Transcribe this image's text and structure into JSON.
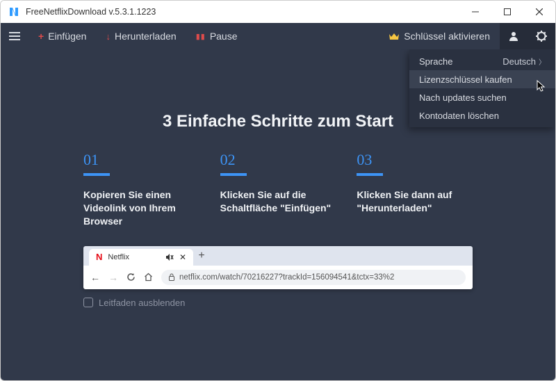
{
  "window": {
    "title": "FreeNetflixDownload  v.5.3.1.1223"
  },
  "toolbar": {
    "paste": "Einfügen",
    "download": "Herunterladen",
    "pause": "Pause",
    "activate": "Schlüssel aktivieren"
  },
  "dropdown": {
    "language_label": "Sprache",
    "language_value": "Deutsch",
    "buy": "Lizenzschlüssel kaufen",
    "updates": "Nach updates suchen",
    "delete": "Kontodaten löschen"
  },
  "main": {
    "heading": "3 Einfache Schritte zum Start",
    "steps": [
      {
        "num": "01",
        "text": "Kopieren Sie einen Videolink von Ihrem Browser"
      },
      {
        "num": "02",
        "text": "Klicken Sie auf die Schaltfläche \"Einfügen\""
      },
      {
        "num": "03",
        "text": "Klicken Sie dann auf \"Herunterladen\""
      }
    ],
    "hide_guide": "Leitfaden ausblenden"
  },
  "browser": {
    "tab_title": "Netflix",
    "url": "netflix.com/watch/70216227?trackId=156094541&tctx=33%2"
  }
}
